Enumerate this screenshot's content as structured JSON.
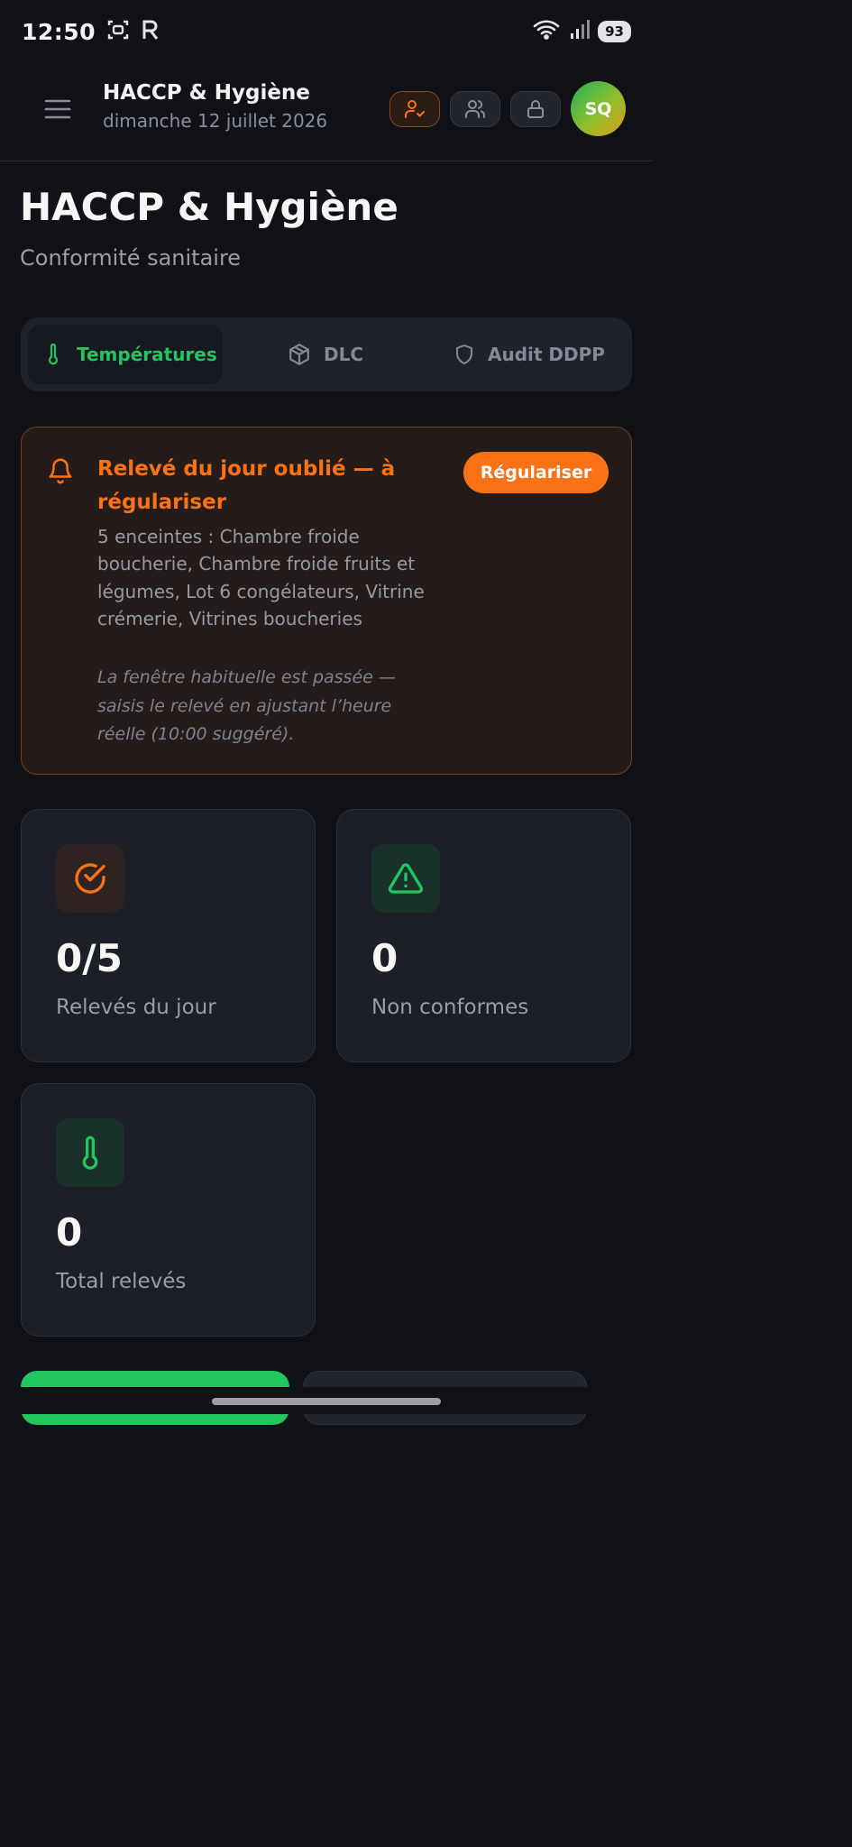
{
  "status_bar": {
    "time": "12:50",
    "battery": "93"
  },
  "header": {
    "title": "HACCP & Hygiène",
    "date": "dimanche 12 juillet 2026",
    "avatar_initials": "SQ"
  },
  "page": {
    "title": "HACCP & Hygiène",
    "subtitle": "Conformité sanitaire"
  },
  "tabs": [
    {
      "label": "Températures",
      "icon": "thermometer-icon",
      "active": true
    },
    {
      "label": "DLC",
      "icon": "package-icon",
      "active": false
    },
    {
      "label": "Audit DDPP",
      "icon": "shield-icon",
      "active": false
    }
  ],
  "alert": {
    "title": "Relevé du jour oublié — à régulariser",
    "body": "5 enceintes : Chambre froide boucherie, Chambre froide fruits et légumes, Lot 6 congélateurs, Vitrine crémerie, Vitrines boucheries",
    "note": "La fenêtre habituelle est passée — saisis le relevé en ajustant l’heure réelle (10:00 suggéré).",
    "button_label": "Régulariser"
  },
  "stats": [
    {
      "value": "0/5",
      "label": "Relevés du jour",
      "icon": "check-circle-icon",
      "tone": "orange"
    },
    {
      "value": "0",
      "label": "Non conformes",
      "icon": "warning-triangle-icon",
      "tone": "green"
    },
    {
      "value": "0",
      "label": "Total relevés",
      "icon": "thermometer-icon",
      "tone": "green"
    }
  ],
  "colors": {
    "background": "#111218",
    "accent_green": "#22c55e",
    "accent_orange": "#f97316",
    "card": "#1c1e28"
  }
}
